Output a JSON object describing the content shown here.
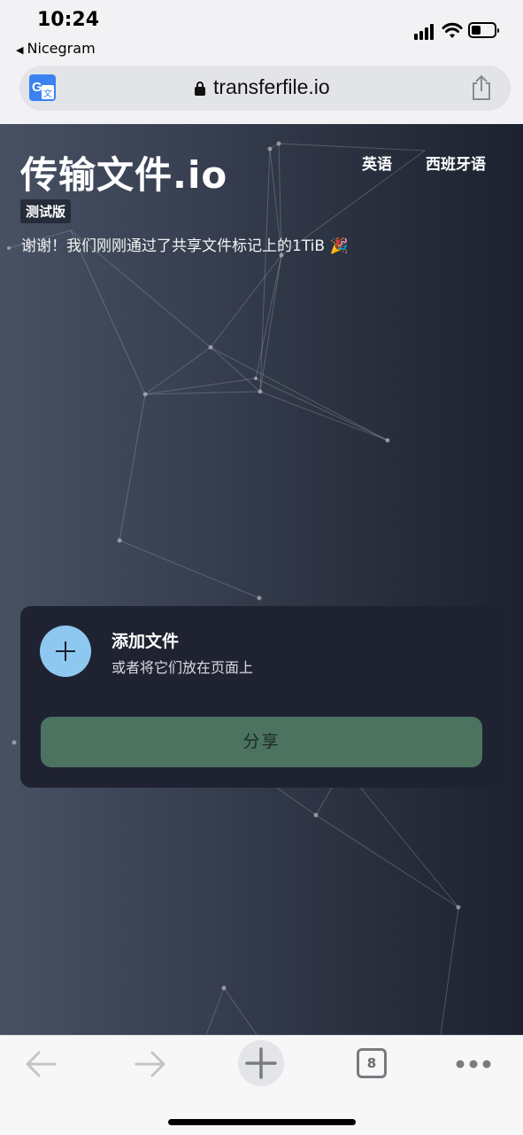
{
  "status": {
    "time": "10:24",
    "back_app": "Nicegram"
  },
  "browser": {
    "url": "transferfile.io",
    "tab_count": "8"
  },
  "site": {
    "brand": "传输文件.io",
    "lang_en": "英语",
    "lang_es": "西班牙语",
    "beta": "测试版",
    "thanks": "谢谢！我们刚刚通过了共享文件标记上的1TiB 🎉"
  },
  "upload": {
    "add_title": "添加文件",
    "add_sub": "或者将它们放在页面上",
    "share": "分享"
  },
  "colors": {
    "accent": "#8ec8f0",
    "share_button": "#4b7360",
    "card": "#1f2331"
  }
}
